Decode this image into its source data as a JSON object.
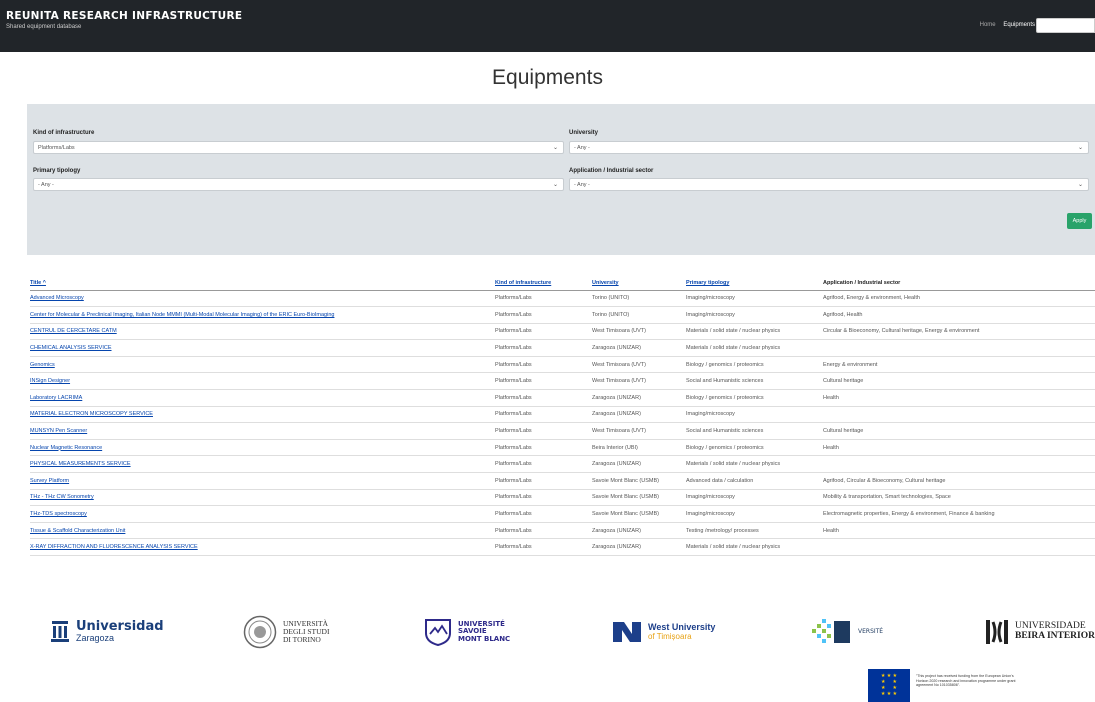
{
  "header": {
    "brand_title": "REUNITA RESEARCH INFRASTRUCTURE",
    "brand_subtitle": "Shared equipment database",
    "nav": {
      "home": "Home",
      "equipments": "Equipments"
    }
  },
  "page": {
    "title": "Equipments"
  },
  "filters": {
    "kind": {
      "label": "Kind of infrastructure",
      "value": "Platforms/Labs"
    },
    "university": {
      "label": "University",
      "value": "- Any -"
    },
    "primary": {
      "label": "Primary tipology",
      "value": "- Any -"
    },
    "application": {
      "label": "Application / Industrial sector",
      "value": "- Any -"
    },
    "apply_label": "Apply"
  },
  "table": {
    "headers": {
      "title": "Title ^",
      "kind": "Kind of infrastructure",
      "university": "University",
      "primary": "Primary tipology",
      "application": "Application / Industrial sector"
    },
    "rows": [
      [
        "Advanced Microscopy",
        "Platforms/Labs",
        "Torino (UNITO)",
        "Imaging/microscopy",
        "Agrifood, Energy & environment, Health"
      ],
      [
        "Center for Molecular & Preclinical Imaging, Italian Node MMMI (Multi-Modal Molecular Imaging) of the ERIC Euro-BioImaging",
        "Platforms/Labs",
        "Torino (UNITO)",
        "Imaging/microscopy",
        "Agrifood, Health"
      ],
      [
        "CENTRUL DE CERCETARE CATM",
        "Platforms/Labs",
        "West Timisoara (UVT)",
        "Materials / solid state / nuclear physics",
        "Circular & Bioeconomy, Cultural heritage, Energy & environment"
      ],
      [
        "CHEMICAL ANALYSIS SERVICE",
        "Platforms/Labs",
        "Zaragoza (UNIZAR)",
        "Materials / solid state / nuclear physics",
        ""
      ],
      [
        "Genomics",
        "Platforms/Labs",
        "West Timisoara (UVT)",
        "Biology / genomics / proteomics",
        "Energy & environment"
      ],
      [
        "INSign Designer",
        "Platforms/Labs",
        "West Timisoara (UVT)",
        "Social and Humanistic sciences",
        "Cultural heritage"
      ],
      [
        "Laboratory LACRIMA",
        "Platforms/Labs",
        "Zaragoza (UNIZAR)",
        "Biology / genomics / proteomics",
        "Health"
      ],
      [
        "MATERIAL ELECTRON MICROSCOPY SERVICE",
        "Platforms/Labs",
        "Zaragoza (UNIZAR)",
        "Imaging/microscopy",
        ""
      ],
      [
        "MUNSYN Pen Scanner",
        "Platforms/Labs",
        "West Timisoara (UVT)",
        "Social and Humanistic sciences",
        "Cultural heritage"
      ],
      [
        "Nuclear Magnetic Resonance",
        "Platforms/Labs",
        "Beira Interior (UBI)",
        "Biology / genomics / proteomics",
        "Health"
      ],
      [
        "PHYSICAL MEASUREMENTS SERVICE",
        "Platforms/Labs",
        "Zaragoza (UNIZAR)",
        "Materials / solid state / nuclear physics",
        ""
      ],
      [
        "Survey Platform",
        "Platforms/Labs",
        "Savoie Mont Blanc (USMB)",
        "Advanced data / calculation",
        "Agrifood, Circular & Bioeconomy, Cultural heritage"
      ],
      [
        "THz - THz CW Sonometry",
        "Platforms/Labs",
        "Savoie Mont Blanc (USMB)",
        "Imaging/microscopy",
        "Mobility & transportation, Smart technologies, Space"
      ],
      [
        "THz-TDS spectroscopy",
        "Platforms/Labs",
        "Savoie Mont Blanc (USMB)",
        "Imaging/microscopy",
        "Electromagnetic properties, Energy & environment, Finance & banking"
      ],
      [
        "Tissue & Scaffold Characterization Unit",
        "Platforms/Labs",
        "Zaragoza (UNIZAR)",
        "Testing /metrology/ processes",
        "Health"
      ],
      [
        "X-RAY DIFFRACTION AND FLUORESCENCE ANALYSIS SERVICE",
        "Platforms/Labs",
        "Zaragoza (UNIZAR)",
        "Materials / solid state / nuclear physics",
        ""
      ]
    ]
  },
  "logos": {
    "zaragoza": {
      "line1": "Universidad",
      "line2": "Zaragoza"
    },
    "torino": {
      "line1": "UNIVERSITÀ",
      "line2": "DEGLI STUDI",
      "line3": "DI TORINO"
    },
    "savoie": {
      "line1": "UNIVERSITÉ",
      "line2": "SAVOIE",
      "line3": "MONT BLANC"
    },
    "west": {
      "line1": "West University",
      "line2": "of Timișoara"
    },
    "fifth": {
      "line1": "VERSITÉ"
    },
    "beira": {
      "line1": "UNIVERSIDADE",
      "line2": "BEIRA INTERIOR"
    }
  },
  "eu_notice": "\"This project has received funding from the European Union's Horizon 2020 research and innovation programme under grant agreement No 101035806\".",
  "colors": {
    "header_bg": "#212529",
    "filter_bg": "#dde2e6",
    "apply_button": "#29a36a",
    "link": "#0645ad"
  }
}
